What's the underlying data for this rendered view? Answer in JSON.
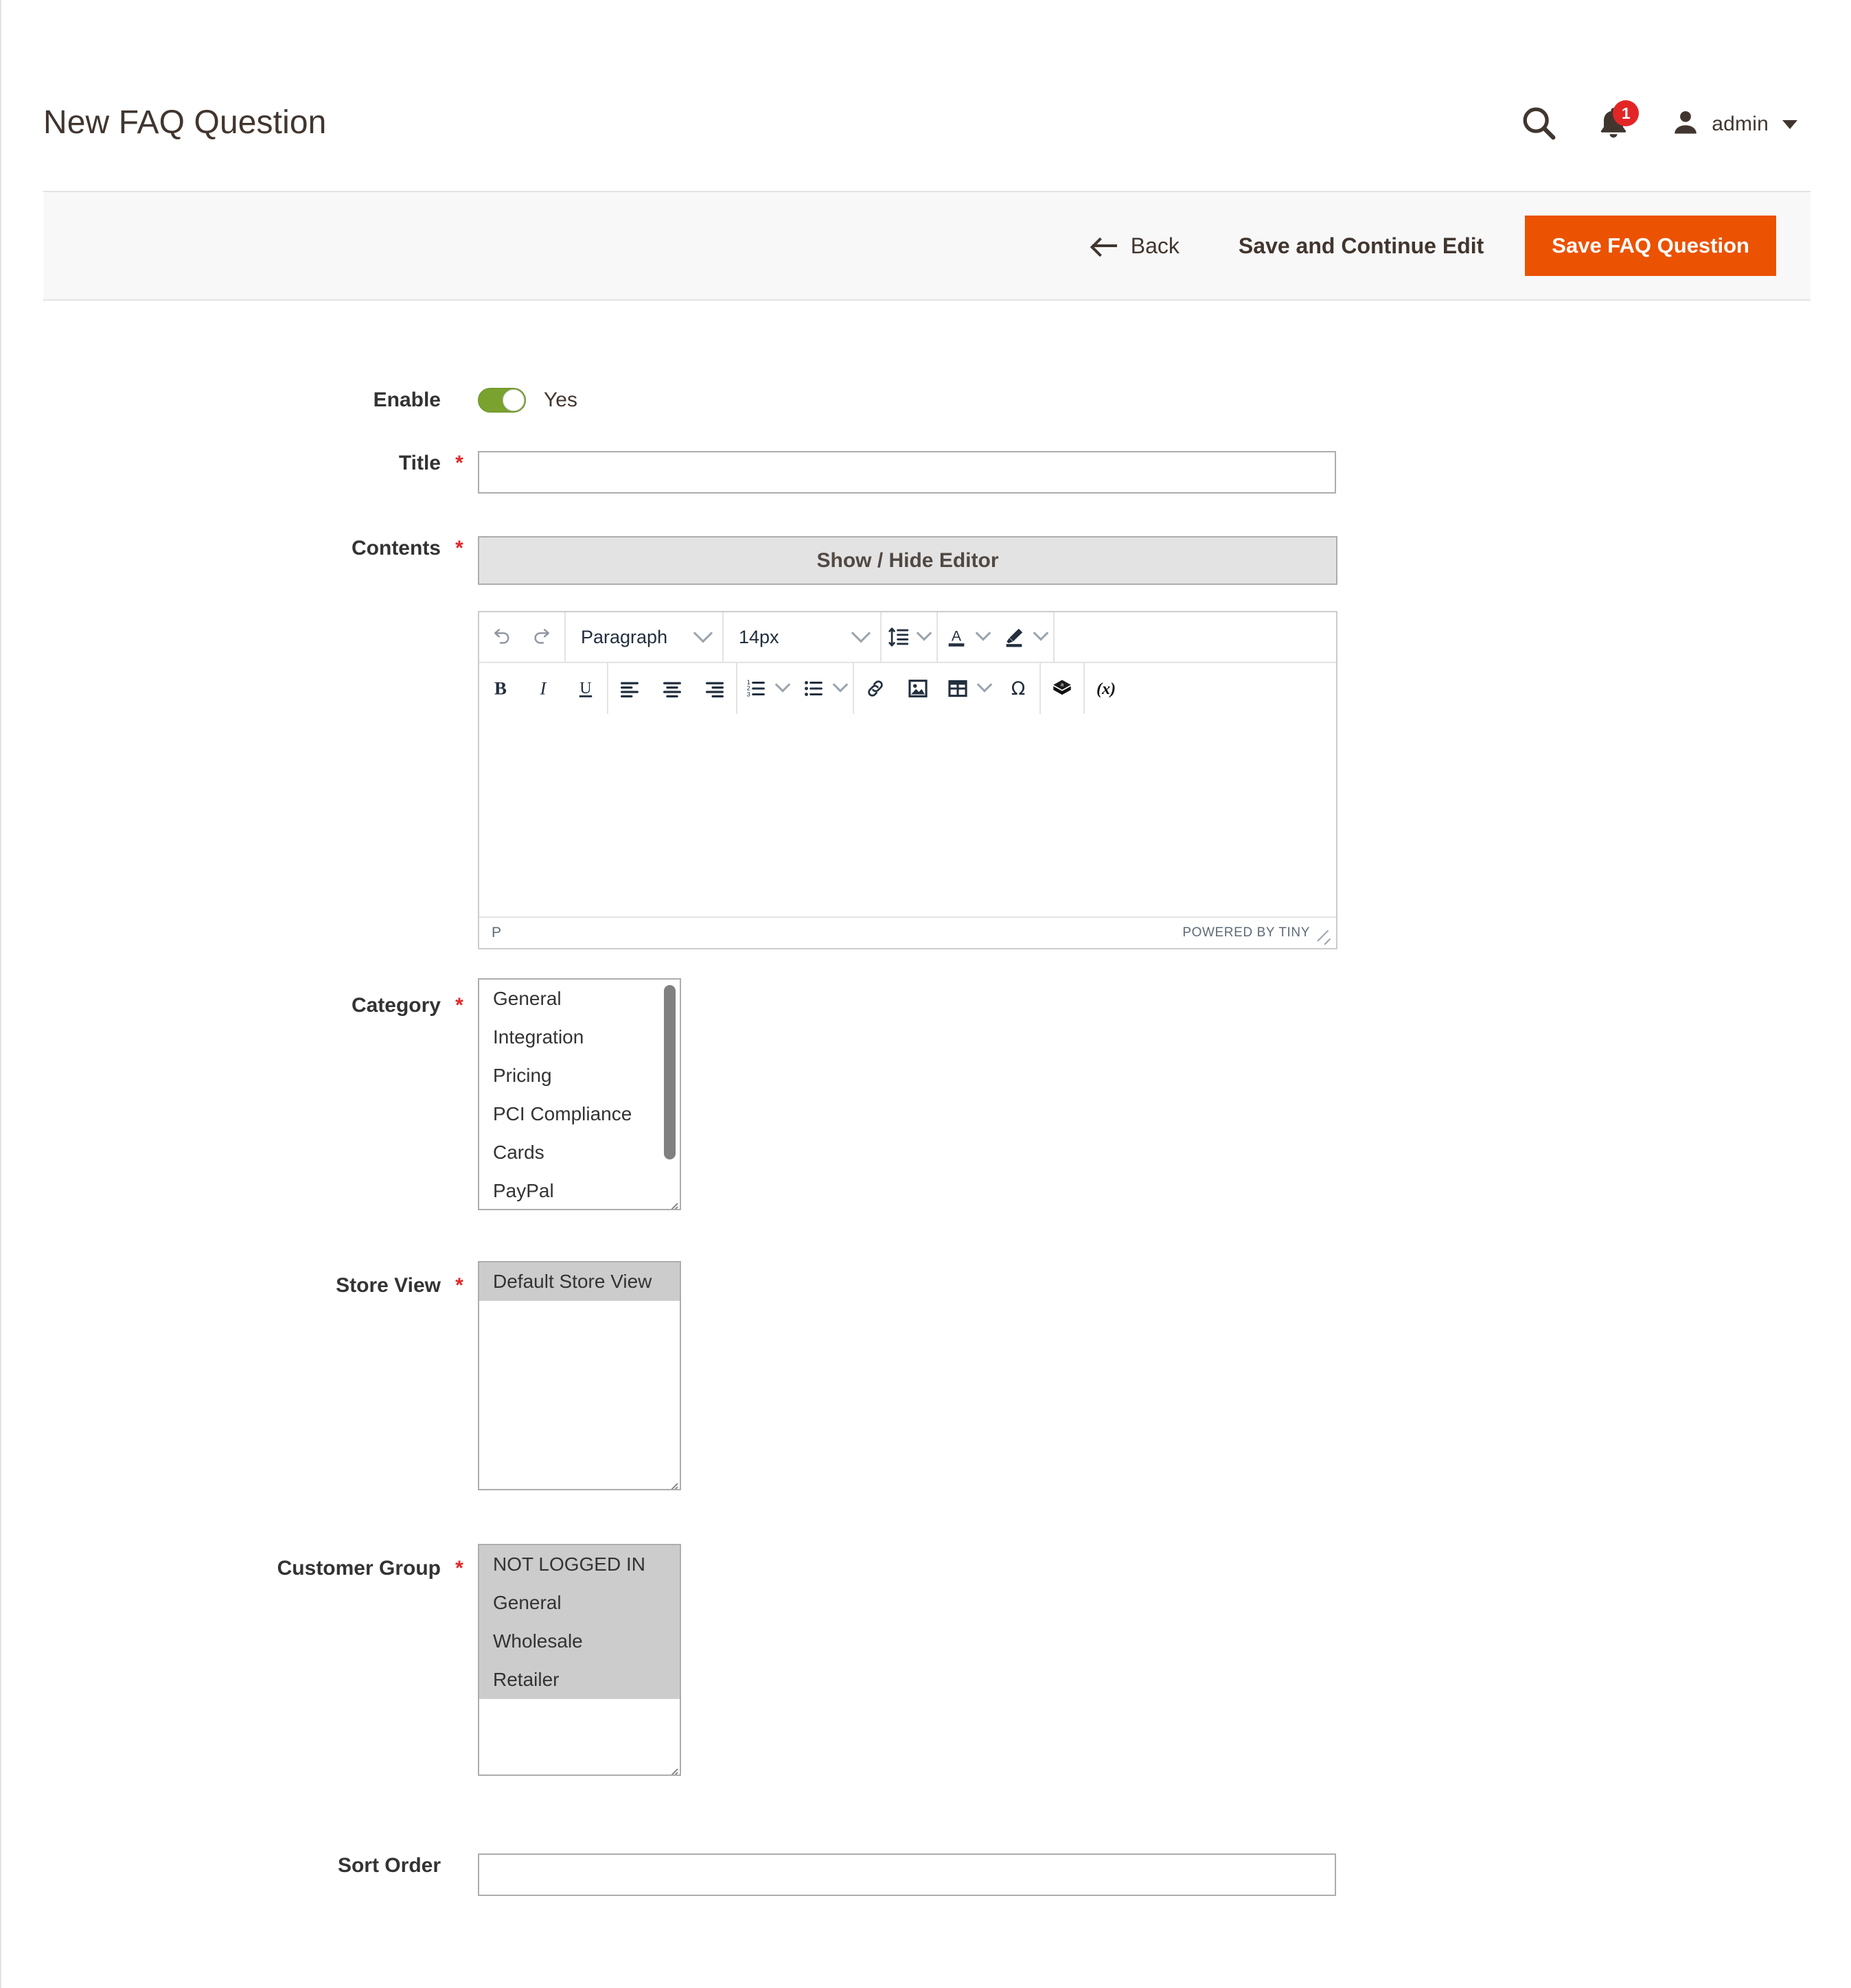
{
  "header": {
    "title": "New FAQ Question",
    "search_icon": "search-icon",
    "notifications_icon": "bell-icon",
    "notifications_count": "1",
    "user_icon": "user-icon",
    "user_name": "admin",
    "caret_icon": "chevron-down-icon"
  },
  "actions": {
    "back_label": "Back",
    "back_icon": "arrow-left-icon",
    "save_continue_label": "Save and Continue Edit",
    "save_label": "Save FAQ Question",
    "primary_color": "#eb5202"
  },
  "form": {
    "enable": {
      "label": "Enable",
      "value": "Yes",
      "toggle_on": true,
      "toggle_color": "#79a22e"
    },
    "title": {
      "label": "Title",
      "required": "*",
      "value": "",
      "placeholder": ""
    },
    "contents": {
      "label": "Contents",
      "required": "*",
      "toggle_editor_label": "Show / Hide Editor",
      "editor": {
        "toolbar_row1": [
          {
            "name": "undo-icon",
            "type": "icon"
          },
          {
            "name": "redo-icon",
            "type": "icon"
          },
          {
            "name": "block-format-select",
            "type": "select",
            "value": "Paragraph"
          },
          {
            "name": "font-size-select",
            "type": "select",
            "value": "14px"
          },
          {
            "name": "line-height-icon",
            "type": "icon-split"
          },
          {
            "name": "text-color-icon",
            "type": "icon-split"
          },
          {
            "name": "background-color-icon",
            "type": "icon-split"
          }
        ],
        "toolbar_row2": [
          {
            "name": "bold-icon",
            "type": "icon"
          },
          {
            "name": "italic-icon",
            "type": "icon"
          },
          {
            "name": "underline-icon",
            "type": "icon"
          },
          {
            "name": "align-left-icon",
            "type": "icon"
          },
          {
            "name": "align-center-icon",
            "type": "icon"
          },
          {
            "name": "align-right-icon",
            "type": "icon"
          },
          {
            "name": "numbered-list-icon",
            "type": "icon-split"
          },
          {
            "name": "bullet-list-icon",
            "type": "icon-split"
          },
          {
            "name": "link-icon",
            "type": "icon"
          },
          {
            "name": "image-icon",
            "type": "icon"
          },
          {
            "name": "table-icon",
            "type": "icon-split"
          },
          {
            "name": "special-character-icon",
            "type": "icon"
          },
          {
            "name": "magento-widget-icon",
            "type": "icon"
          },
          {
            "name": "magento-variable-icon",
            "type": "icon"
          }
        ],
        "body_text": "",
        "status_path": "P",
        "branding": "POWERED BY TINY"
      }
    },
    "category": {
      "label": "Category",
      "required": "*",
      "options": [
        {
          "label": "General",
          "selected": false
        },
        {
          "label": "Integration",
          "selected": false
        },
        {
          "label": "Pricing",
          "selected": false
        },
        {
          "label": "PCI Compliance",
          "selected": false
        },
        {
          "label": "Cards",
          "selected": false
        },
        {
          "label": "PayPal",
          "selected": false
        }
      ]
    },
    "store_view": {
      "label": "Store View",
      "required": "*",
      "options": [
        {
          "label": "Default Store View",
          "selected": true
        }
      ]
    },
    "customer_group": {
      "label": "Customer Group",
      "required": "*",
      "options": [
        {
          "label": "NOT LOGGED IN",
          "selected": true
        },
        {
          "label": "General",
          "selected": true
        },
        {
          "label": "Wholesale",
          "selected": true
        },
        {
          "label": "Retailer",
          "selected": true
        }
      ]
    },
    "sort_order": {
      "label": "Sort Order",
      "required": "",
      "value": "",
      "placeholder": ""
    }
  }
}
